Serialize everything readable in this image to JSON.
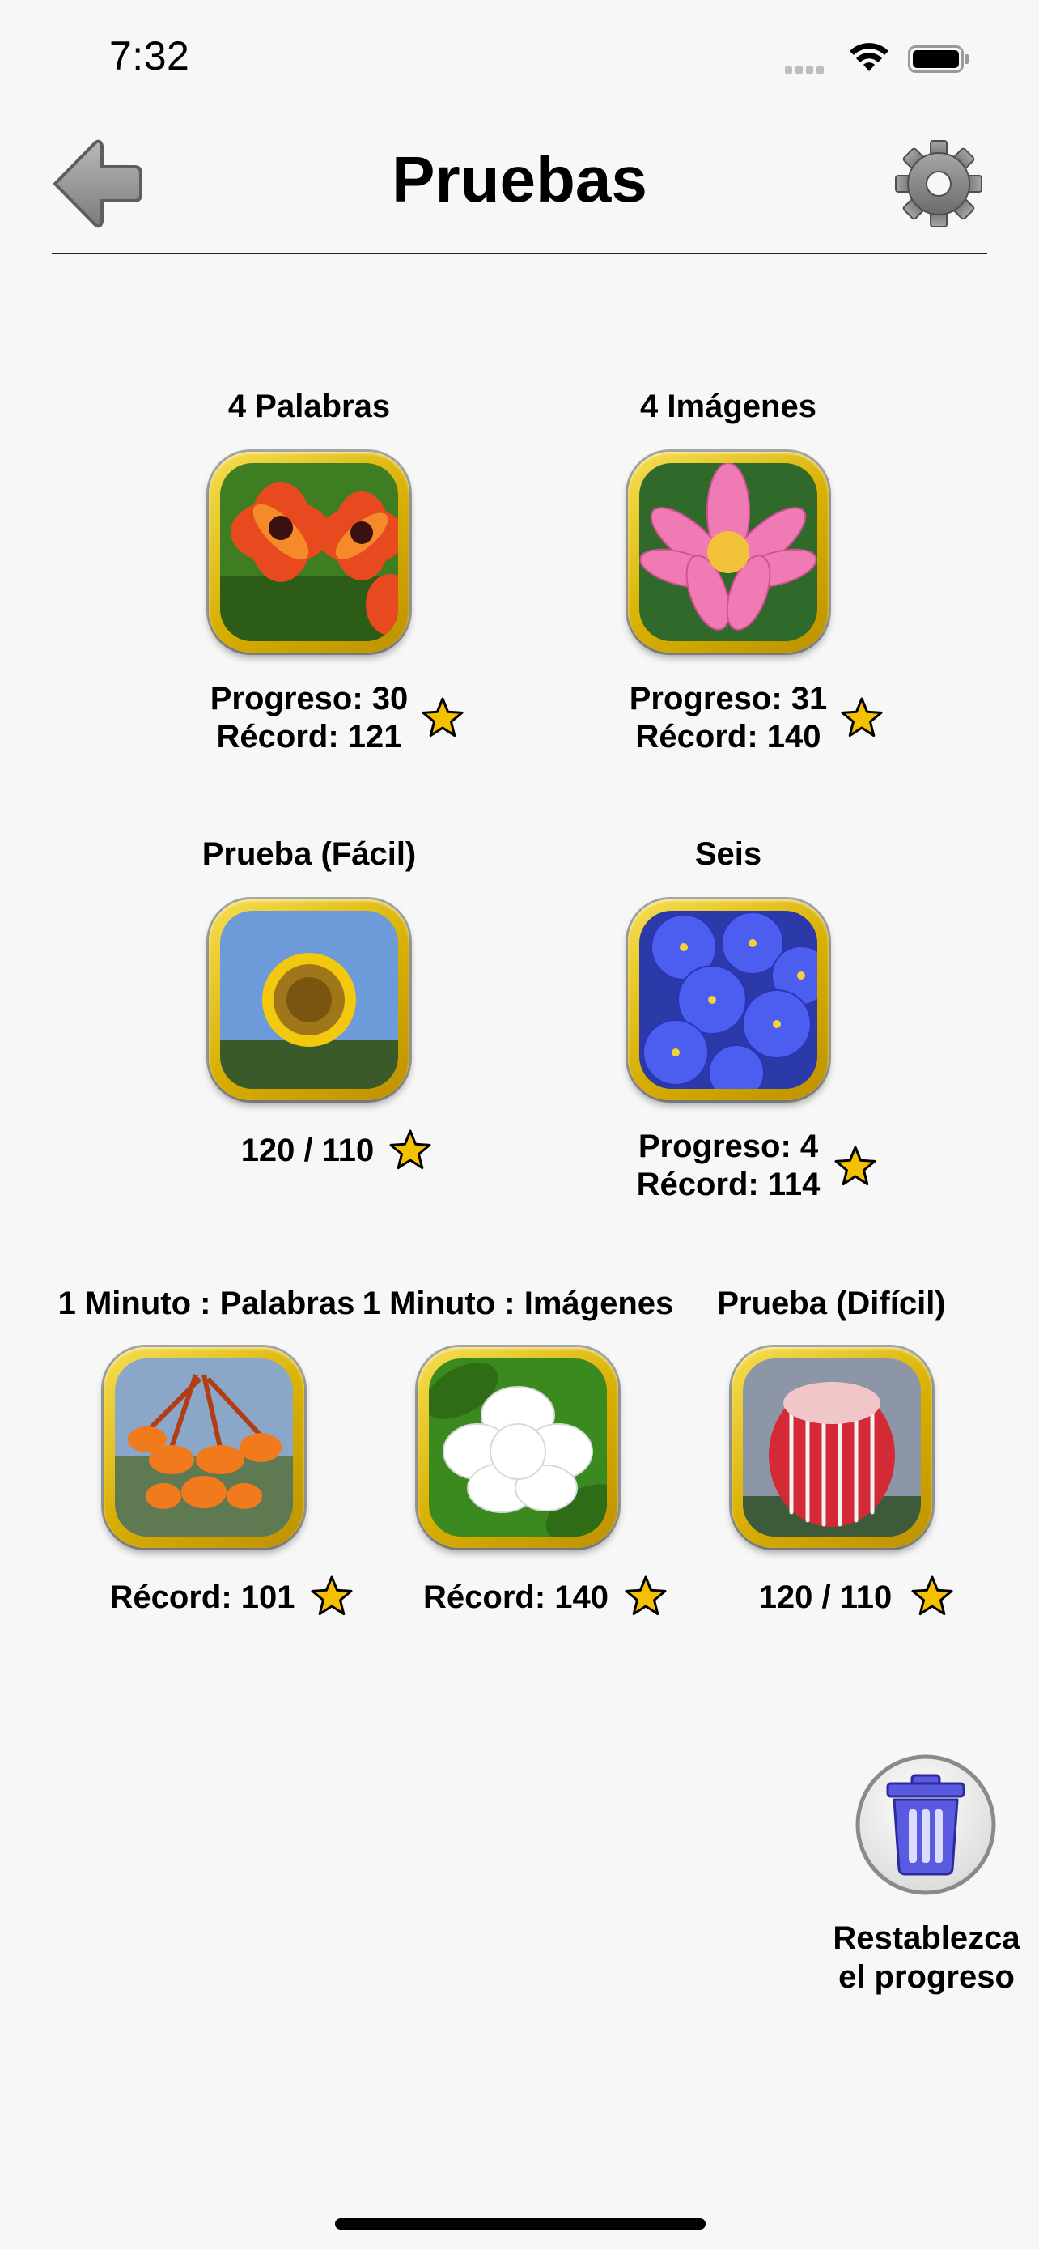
{
  "status_bar": {
    "time": "7:32"
  },
  "header": {
    "title": "Pruebas"
  },
  "tiles": [
    {
      "title": "4 Palabras",
      "line1": "Progreso: 30",
      "line2": "Récord: 121"
    },
    {
      "title": "4 Imágenes",
      "line1": "Progreso: 31",
      "line2": "Récord: 140"
    },
    {
      "title": "Prueba (Fácil)",
      "line1": "120 / 110"
    },
    {
      "title": "Seis",
      "line1": "Progreso: 4",
      "line2": "Récord: 114"
    },
    {
      "title": "1 Minuto : Palabras",
      "line1": "Récord: 101"
    },
    {
      "title": "1 Minuto : Imágenes",
      "line1": "Récord: 140"
    },
    {
      "title": "Prueba (Difícil)",
      "line1": "120 / 110"
    }
  ],
  "reset": {
    "label_line1": "Restablezca",
    "label_line2": "el progreso"
  },
  "icons": {
    "back": "back-arrow-icon",
    "settings": "gear-icon",
    "star": "star-icon",
    "reset": "trash-icon"
  },
  "colors": {
    "star_fill": "#f5c000",
    "frame_gold": "#d7ae00",
    "trash_blue": "#5a5ae0"
  }
}
